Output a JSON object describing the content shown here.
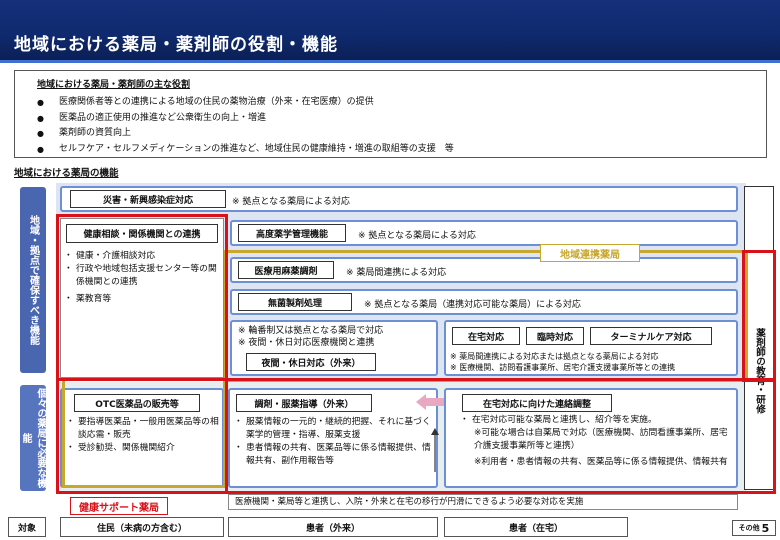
{
  "header": {
    "title": "地域における薬局・薬剤師の役割・機能"
  },
  "roles": {
    "title": "地域における薬局・薬剤師の主な役割",
    "items": [
      "医療関係者等との連携による地域の住民の薬物治療（外来・在宅医療）の提供",
      "医薬品の適正使用の推進など公衆衛生の向上・増進",
      "薬剤師の資質向上",
      "セルフケア・セルフメディケーションの推進など、地域住民の健康維持・増進の取組等の支援　等"
    ]
  },
  "functions": {
    "title": "地域における薬局の機能",
    "left_top_label": "地域・拠点で確保すべき機能",
    "left_bottom_label": "個々の薬局に必要な機能",
    "right_label": "薬剤師の教育・研修",
    "disaster": {
      "label": "災害・新興感染症対応",
      "note": "※ 拠点となる薬局による対応"
    },
    "health": {
      "label": "健康相談・関係機関との連携",
      "items": [
        "健康・介護相談対応",
        "行政や地域包括支援センター等の関係機関との連携",
        "薬教育等"
      ]
    },
    "advanced": {
      "label": "高度薬学管理機能",
      "note": "※ 拠点となる薬局による対応"
    },
    "narcotic": {
      "label": "医療用麻薬調剤",
      "note": "※ 薬局間連携による対応"
    },
    "sterile": {
      "label": "無菌製剤処理",
      "note": "※ 拠点となる薬局（連携対応可能な薬局）による対応"
    },
    "regional_tag": "地域連携薬局",
    "holiday": {
      "notes": [
        "※ 輪番制又は拠点となる薬局で対応",
        "※ 夜間・休日対応医療機関と連携"
      ],
      "label": "夜間・休日対応（外来）"
    },
    "home": {
      "labels": [
        "在宅対応",
        "臨時対応",
        "ターミナルケア対応"
      ],
      "notes": [
        "※ 薬局間連携による対応または拠点となる薬局による対応",
        "※ 医療機関、訪問看護事業所、居宅介護支援事業所等との連携"
      ]
    },
    "otc": {
      "label": "OTC医薬品の販売等",
      "items": [
        "要指導医薬品・一般用医薬品等の相談応需・販売",
        "受診勧奨、関係機関紹介"
      ]
    },
    "dispensing": {
      "label": "調剤・服薬指導（外来）",
      "items": [
        "服薬情報の一元的・継続的把握、それに基づく薬学的管理・指導、服薬支援",
        "患者情報の共有、医薬品等に係る情報提供、情報共有、副作用報告等"
      ]
    },
    "home_coord": {
      "label": "在宅対応に向けた連絡調整",
      "items": [
        "在宅対応可能な薬局と連携し、紹介等を実施。"
      ],
      "subnotes": [
        "※可能な場合は自薬局で対応（医療機関、訪問看護事業所、居宅介護支援事業所等と連携）",
        "※利用者・患者情報の共有、医薬品等に係る情報提供、情報共有"
      ]
    },
    "support_tag": "健康サポート薬局",
    "transition_note": "医療機関・薬局等と連携し、入院・外来と在宅の移行が円滑にできるよう必要な対応を実施"
  },
  "targets": {
    "label": "対象",
    "items": [
      "住民（未病の方含む）",
      "患者（外来）",
      "患者（在宅）"
    ]
  },
  "footer": {
    "page_label": "その他",
    "page_number": "5"
  },
  "colors": {
    "banner": "#0f2a6e",
    "red": "#d9121a",
    "gold": "#c8a72e",
    "blue_border": "#6c8fd6"
  }
}
